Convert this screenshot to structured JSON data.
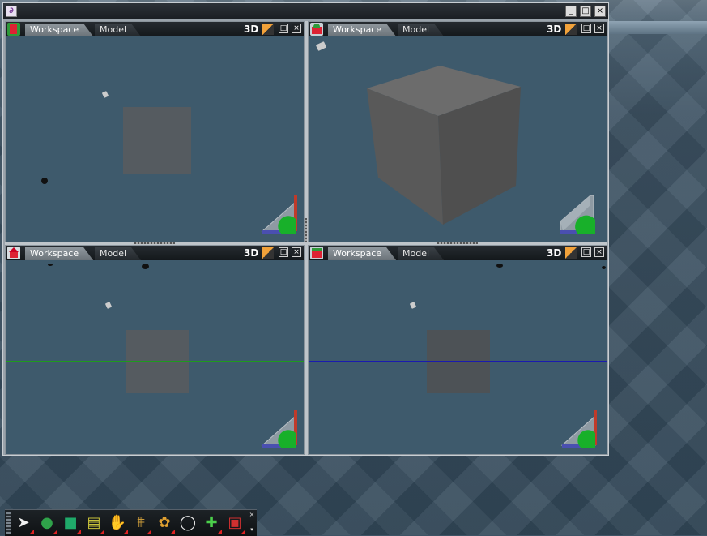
{
  "colors": {
    "tab_active": "#7d858b",
    "viewport_bg": "#3e5a6c",
    "cube_front": "#5b5b5b",
    "axis_green": "#1e9a1e",
    "axis_blue": "#1a1ab0",
    "flag_orange": "#f2a23a"
  },
  "window": {
    "app_icon": "app-logo-icon",
    "controls": {
      "minimize": "_",
      "maximize": "□",
      "close": "×"
    }
  },
  "viewports": [
    {
      "icon": "front-view-icon",
      "tabs": [
        "Workspace",
        "Model"
      ],
      "mode": "3D",
      "max": "□",
      "close": "×"
    },
    {
      "icon": "perspective-view-icon",
      "tabs": [
        "Workspace",
        "Model"
      ],
      "mode": "3D",
      "max": "□",
      "close": "×"
    },
    {
      "icon": "top-view-icon",
      "tabs": [
        "Workspace",
        "Model"
      ],
      "mode": "3D",
      "max": "□",
      "close": "×"
    },
    {
      "icon": "side-view-icon",
      "tabs": [
        "Workspace",
        "Model"
      ],
      "mode": "3D",
      "max": "□",
      "close": "×"
    }
  ],
  "toolbar": {
    "tools": [
      {
        "name": "select-tool-icon",
        "glyph": "➤"
      },
      {
        "name": "material-sphere-icon",
        "glyph": "●"
      },
      {
        "name": "box-primitive-icon",
        "glyph": "■"
      },
      {
        "name": "layer-stack-icon",
        "glyph": "▤"
      },
      {
        "name": "gripper-tool-icon",
        "glyph": "✋"
      },
      {
        "name": "stairs-tool-icon",
        "glyph": "⩩"
      },
      {
        "name": "color-palette-icon",
        "glyph": "✿"
      },
      {
        "name": "torus-primitive-icon",
        "glyph": "◯"
      },
      {
        "name": "add-light-icon",
        "glyph": "✚"
      },
      {
        "name": "toolbox-icon",
        "glyph": "▣"
      }
    ],
    "close": "×",
    "more": "▾"
  }
}
